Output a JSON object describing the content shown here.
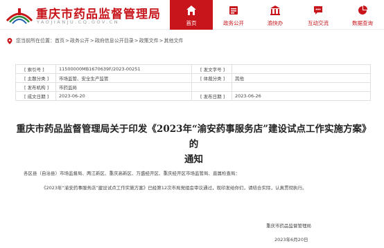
{
  "header": {
    "site_title": "重庆市药品监督管理局",
    "site_url": "YAOJIANJU.CQ.GOV.CN",
    "brand_color": "#c8151b",
    "nav": [
      {
        "label": "首页",
        "icon": "home-icon",
        "active": true
      },
      {
        "label": "政务公开",
        "icon": "document-list-icon",
        "active": false
      },
      {
        "label": "渝快办",
        "icon": "government-building-icon",
        "active": false
      },
      {
        "label": "互动交流",
        "icon": "chat-bubble-icon",
        "active": false
      },
      {
        "label": "数据查询",
        "icon": "pie-chart-icon",
        "active": false
      }
    ]
  },
  "breadcrumb": {
    "prefix": "您当前所在位置：",
    "items": [
      "首页",
      "政务公开",
      "政府信息公开目录",
      "政策文件",
      "其他文件"
    ],
    "separator": ">"
  },
  "info_table": {
    "index_no_label": "[ 索引号 ]",
    "index_no": "11500000MB1670639F/2023-00251",
    "doc_no_label": "[ 发文字号 ]",
    "doc_no": "",
    "topic_label": "[ 主题分类 ]",
    "topic": "市场监管、安全生产监管",
    "genre_label": "[ 体裁分类 ]",
    "genre": "其他",
    "issuer_label": "[ 发布机构 ]",
    "issuer": "市药监局",
    "created_label": "[ 成文日期 ]",
    "created": "2023-06-20",
    "published_label": "[ 发布日期 ]",
    "published": "2023-06-26"
  },
  "article": {
    "title_line1": "重庆市药品监督管理局关于印发《2023年“渝安药事服务店”建设试点工作实施方案》的",
    "title_line2": "通知",
    "para1": "各区县（自治县）市场监督局、两江新区、重庆高新区、万盛经开区、重庆经开区市场监管局、直属检查局：",
    "para2": "《2023年“渝安药事服务店”建设试点工作实施方案》已经第12次市局党组会审议通过，现印发给你们，请结合实际，认真贯彻执行。",
    "signature": "重庆市药品监督管理局",
    "date": "2023年6月20日"
  }
}
